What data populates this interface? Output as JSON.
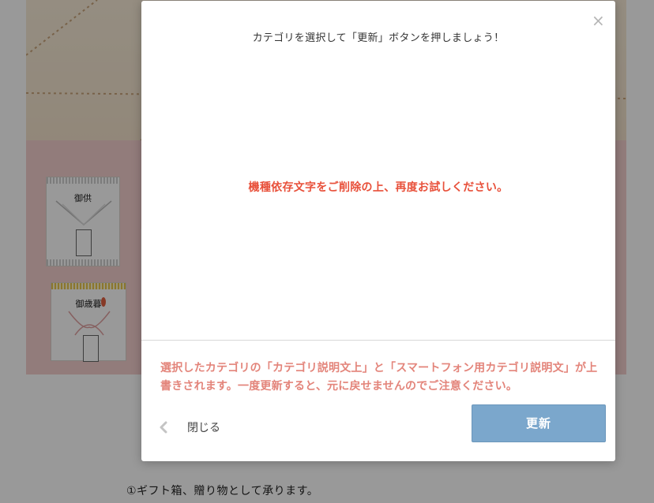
{
  "background": {
    "noshi_1_script": "御供",
    "noshi_2_script": "御歳暮",
    "caption": "①ギフト箱、贈り物として承ります。"
  },
  "modal": {
    "title": "カテゴリを選択して「更新」ボタンを押しましょう！",
    "error_message": "機種依存文字をご削除の上、再度お試しください。",
    "warning_line_1": "選択したカテゴリの「カテゴリ説明文上」と「スマートフォン用カテゴリ説明文」が上",
    "warning_line_2": "書きされます。一度更新すると、元に戻せませんのでご注意ください。",
    "close_label": "閉じる",
    "update_label": "更新",
    "close_icon": "×"
  },
  "colors": {
    "error_red": "#e8503a",
    "warning_pink": "#e3847a",
    "update_button": "#7ba7cc"
  },
  "icons": {
    "close": "close-icon",
    "back": "chevron-left-icon"
  }
}
